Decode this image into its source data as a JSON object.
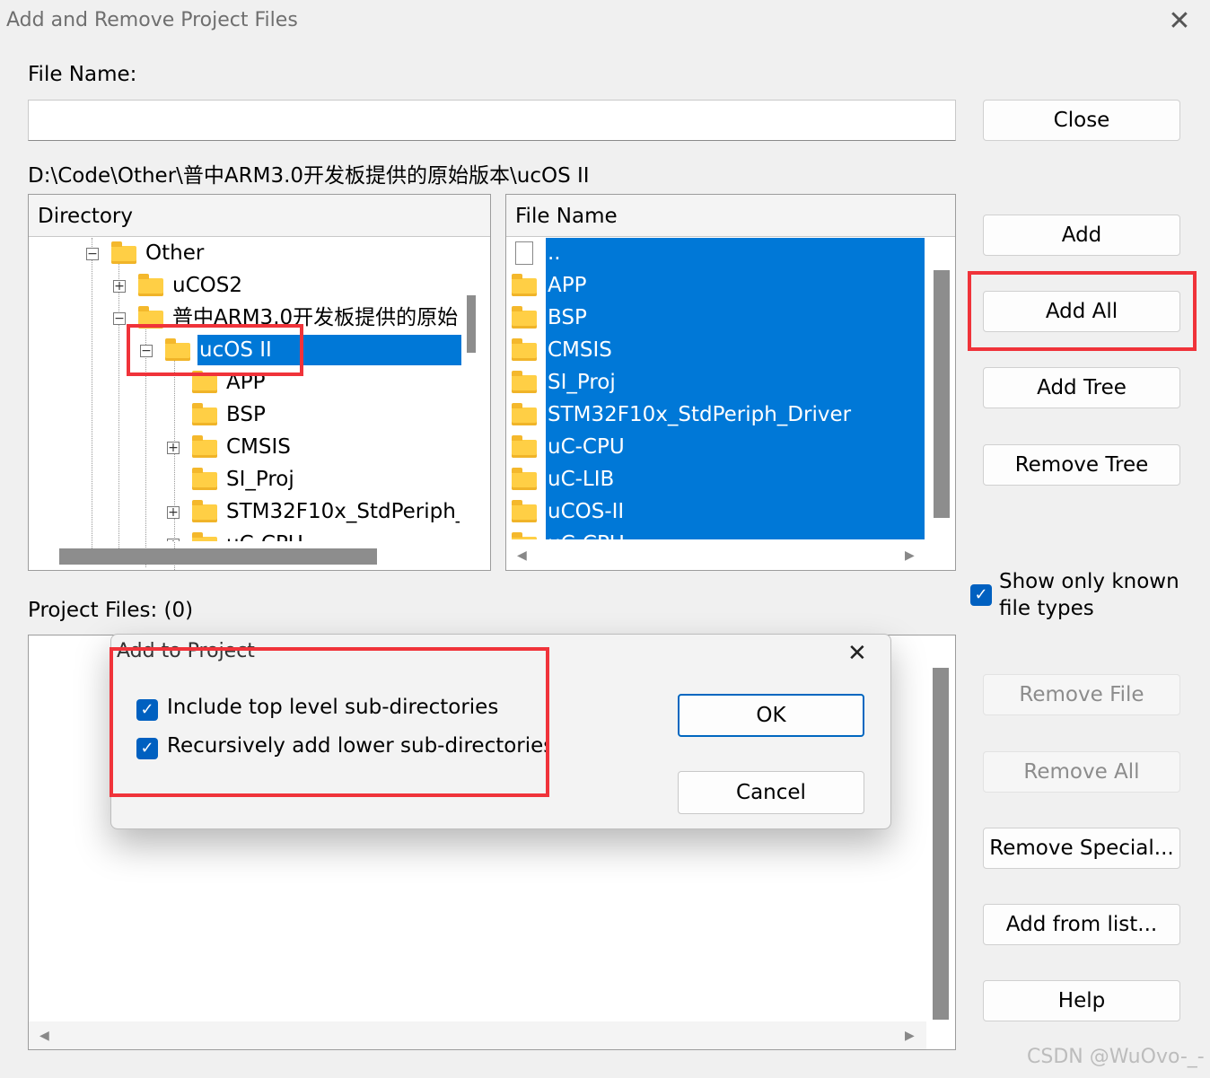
{
  "window": {
    "title": "Add and Remove Project Files",
    "close_glyph": "✕"
  },
  "file_name": {
    "label": "File Name:",
    "value": ""
  },
  "path": "D:\\Code\\Other\\普中ARM3.0开发板提供的原始版本\\ucOS II",
  "directory": {
    "header": "Directory",
    "rows": [
      {
        "label": "Other",
        "expander": "⊟"
      },
      {
        "label": "uCOS2",
        "expander": "⊞"
      },
      {
        "label": "普中ARM3.0开发板提供的原始",
        "expander": "⊟"
      },
      {
        "label": "ucOS II",
        "expander": "⊟",
        "selected": true
      },
      {
        "label": "APP",
        "expander": ""
      },
      {
        "label": "BSP",
        "expander": ""
      },
      {
        "label": "CMSIS",
        "expander": "⊞"
      },
      {
        "label": "SI_Proj",
        "expander": ""
      },
      {
        "label": "STM32F10x_StdPeriph_",
        "expander": "⊞"
      },
      {
        "label": "uC-CPU",
        "expander": "⊞"
      }
    ]
  },
  "file_list": {
    "header": "File Name",
    "rows": [
      {
        "label": "..",
        "type": "file"
      },
      {
        "label": "APP",
        "type": "folder"
      },
      {
        "label": "BSP",
        "type": "folder"
      },
      {
        "label": "CMSIS",
        "type": "folder"
      },
      {
        "label": "SI_Proj",
        "type": "folder"
      },
      {
        "label": "STM32F10x_StdPeriph_Driver",
        "type": "folder"
      },
      {
        "label": "uC-CPU",
        "type": "folder"
      },
      {
        "label": "uC-LIB",
        "type": "folder"
      },
      {
        "label": "uCOS-II",
        "type": "folder"
      },
      {
        "label": "uC-CPU",
        "type": "folder"
      }
    ]
  },
  "buttons": {
    "close": "Close",
    "add": "Add",
    "add_all": "Add All",
    "add_tree": "Add Tree",
    "remove_tree": "Remove Tree",
    "remove_file": "Remove File",
    "remove_all": "Remove All",
    "remove_special": "Remove Special...",
    "add_from_list": "Add from list...",
    "help": "Help"
  },
  "show_known": {
    "label_line1": "Show only known",
    "label_line2": "file types",
    "checked": true
  },
  "project_files": {
    "label": "Project Files: (0)"
  },
  "add_dialog": {
    "title": "Add to Project",
    "close_glyph": "✕",
    "option1": "Include top level sub-directories",
    "option2": "Recursively add lower sub-directories",
    "ok": "OK",
    "cancel": "Cancel"
  },
  "icons": {
    "check": "✓",
    "arrow_left": "◀",
    "arrow_right": "▶"
  },
  "colors": {
    "selection": "#0078d7",
    "highlight_box": "#f0333a",
    "checkbox": "#0060c0"
  },
  "watermark": "CSDN @WuOvo-_-"
}
